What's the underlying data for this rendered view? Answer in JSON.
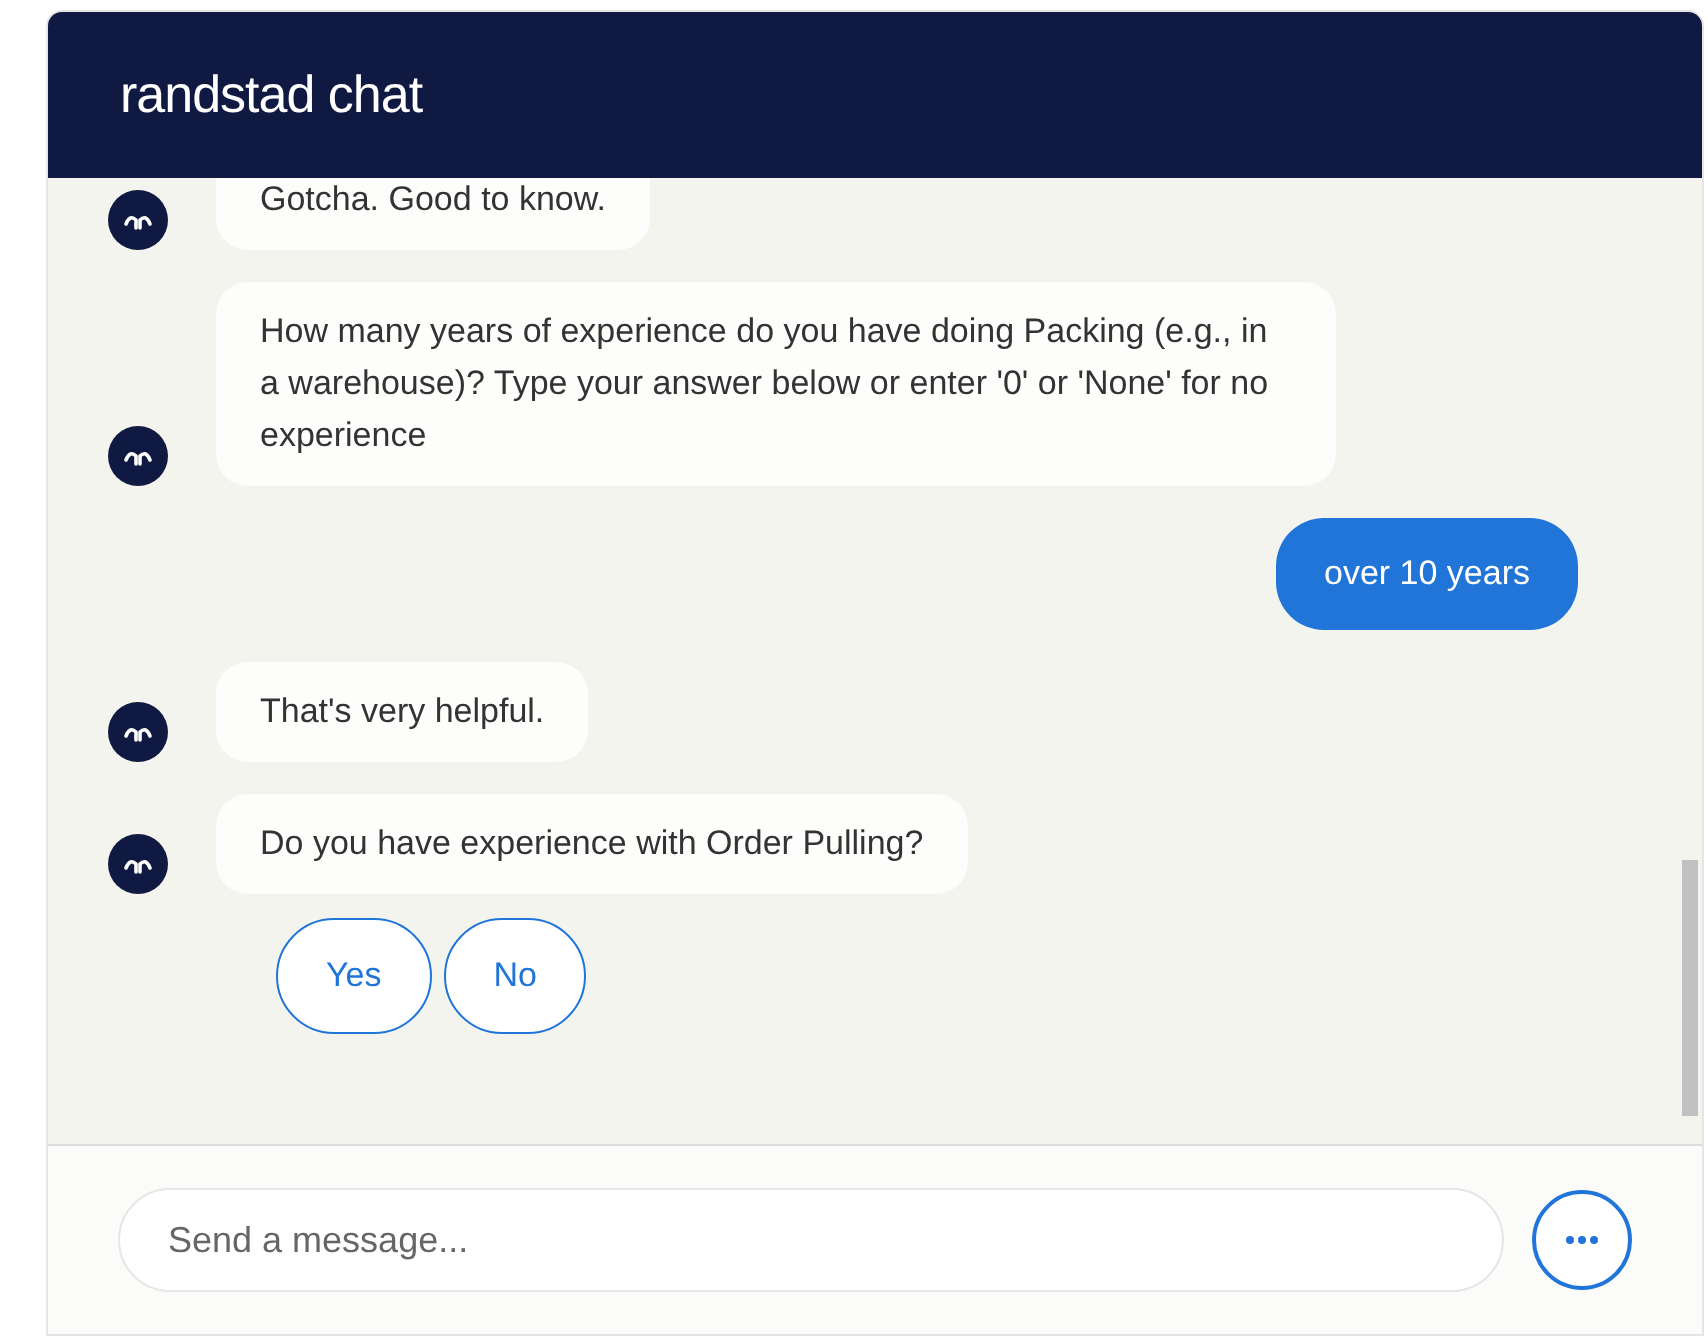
{
  "header": {
    "title": "randstad chat"
  },
  "messages": [
    {
      "kind": "bot",
      "text": "Gotcha. Good to know."
    },
    {
      "kind": "bot",
      "text": "How many years of experience do you have doing Packing (e.g., in a warehouse)? Type your answer below or enter '0' or 'None' for no experience"
    },
    {
      "kind": "user",
      "text": "over 10 years"
    },
    {
      "kind": "bot",
      "text": "That's very helpful."
    },
    {
      "kind": "bot",
      "text": "Do you have experience with Order Pulling?"
    }
  ],
  "quick_replies": [
    "Yes",
    "No"
  ],
  "composer": {
    "placeholder": "Send a message..."
  }
}
